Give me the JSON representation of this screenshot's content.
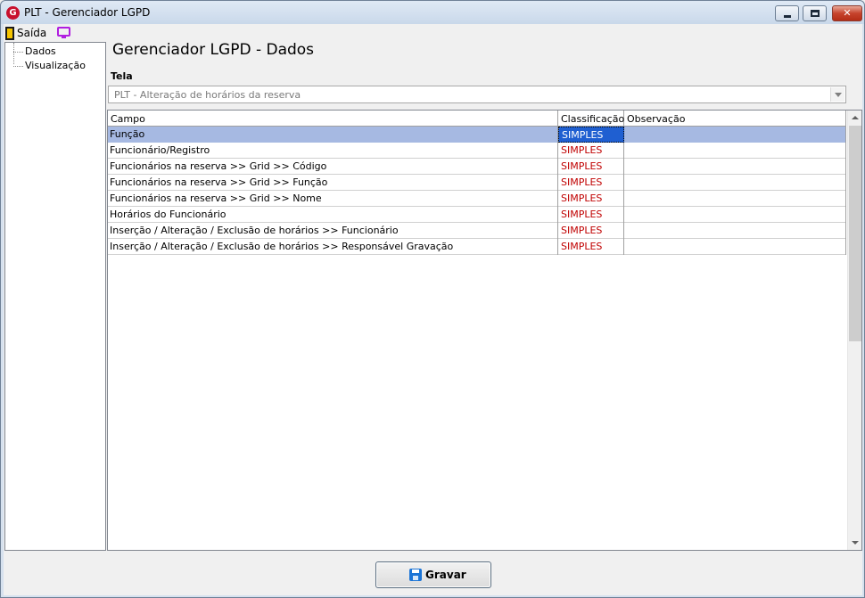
{
  "window": {
    "title": "PLT - Gerenciador LGPD",
    "app_icon_letter": "G",
    "min_glyph": "",
    "max_glyph": "",
    "close_glyph": "✕"
  },
  "menu": {
    "saida_label": "Saída",
    "saida_icon": "exit-door-icon",
    "screen_icon": "monitor-icon"
  },
  "sidebar": {
    "items": [
      {
        "label": "Dados"
      },
      {
        "label": "Visualização"
      }
    ]
  },
  "main": {
    "title": "Gerenciador LGPD - Dados",
    "tela_label": "Tela",
    "tela_value": "PLT - Alteração de horários da reserva"
  },
  "grid": {
    "columns": [
      "Campo",
      "Classificação",
      "Observação"
    ],
    "rows": [
      {
        "campo": "Função",
        "classificacao": "SIMPLES",
        "observacao": ""
      },
      {
        "campo": "Funcionário/Registro",
        "classificacao": "SIMPLES",
        "observacao": ""
      },
      {
        "campo": "Funcionários na reserva >> Grid >> Código",
        "classificacao": "SIMPLES",
        "observacao": ""
      },
      {
        "campo": "Funcionários na reserva >> Grid >> Função",
        "classificacao": "SIMPLES",
        "observacao": ""
      },
      {
        "campo": "Funcionários na reserva >> Grid >> Nome",
        "classificacao": "SIMPLES",
        "observacao": ""
      },
      {
        "campo": "Horários do Funcionário",
        "classificacao": "SIMPLES",
        "observacao": ""
      },
      {
        "campo": "Inserção / Alteração / Exclusão de horários >> Funcionário",
        "classificacao": "SIMPLES",
        "observacao": ""
      },
      {
        "campo": "Inserção / Alteração / Exclusão de horários >> Responsável Gravação",
        "classificacao": "SIMPLES",
        "observacao": ""
      }
    ],
    "selected_row": 0
  },
  "footer": {
    "gravar_label": "Gravar"
  },
  "colors": {
    "classification_text": "#c00000",
    "selection_row": "#a6b9e2",
    "selection_cell": "#1f5fd1"
  }
}
